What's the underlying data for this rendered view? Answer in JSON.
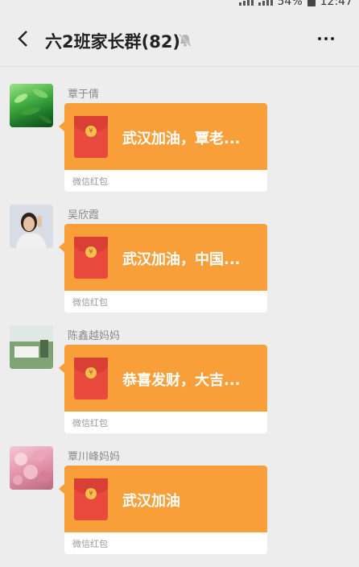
{
  "status": {
    "battery": "54%",
    "time": "12:47"
  },
  "header": {
    "title": "六2班家长群(82)"
  },
  "messages": [
    {
      "sender": "覃于倩",
      "text": "武汉加油，覃老...",
      "footer": "微信红包",
      "avatar": "green-leaves"
    },
    {
      "sender": "吴欣霞",
      "text": "武汉加油，中国...",
      "footer": "微信红包",
      "avatar": "woman-portrait"
    },
    {
      "sender": "陈鑫越妈妈",
      "text": "恭喜发财，大吉...",
      "footer": "微信红包",
      "avatar": "outdoor-scene"
    },
    {
      "sender": "覃川峰妈妈",
      "text": "武汉加油",
      "footer": "微信红包",
      "avatar": "pink-flowers"
    }
  ],
  "colors": {
    "packet": "#f89f3a",
    "envelope": "#e84a3e",
    "background": "#ededed"
  }
}
